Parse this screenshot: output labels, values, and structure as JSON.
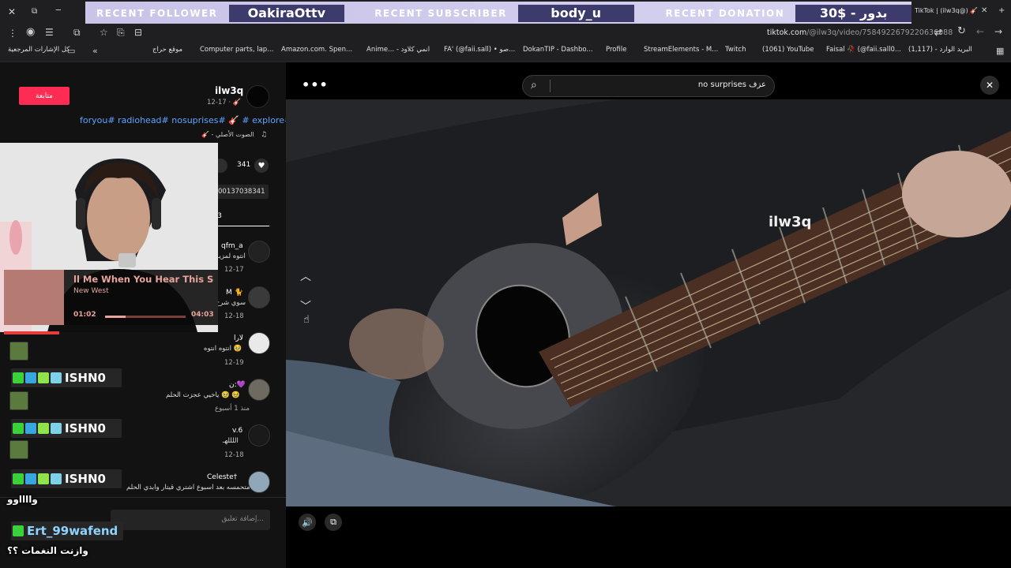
{
  "stream_overlay": {
    "recent_follower_label": "RECENT FOLLOWER",
    "recent_follower_value": "OakiraOttv",
    "recent_subscriber_label": "RECENT SUBSCRIBER",
    "recent_subscriber_value": "body_u",
    "recent_donation_label": "RECENT DONATION",
    "recent_donation_value": "30$ - بدور"
  },
  "browser": {
    "tab_title": "TikTok | (ilw3q@) 🎸",
    "url_host": "tiktok.com",
    "url_path": "/@ilw3q/video/7584922679220636088",
    "bookmarks_all_label": "كل الإشارات المرجعية",
    "bookmarks": [
      "موقع حراج",
      "Computer parts, lap...",
      "Amazon.com. Spen...",
      "Anime... - انمي كلاود",
      "FA' (@faii.sall) • صو...",
      "DokanTIP - Dashbo...",
      "Profile",
      "StreamElements - M...",
      "Twitch",
      "(1061) YouTube",
      "Faisal 🥀 (@faii.sall0...",
      "(1,117) - البريد الوارد"
    ]
  },
  "post": {
    "follow_label": "متابعة",
    "username": "ilw3q",
    "date": "12-17 · 🎸",
    "hashtags": "foryou# radiohead# nosuprises# 🎸 # explore#",
    "sound": "🎸 - الصوت الأصلي",
    "likes": "341",
    "link_fragment": "00137038341",
    "tab_count": "(3"
  },
  "comments": [
    {
      "name": "qfm_a",
      "text": "انتوه لمزيـ",
      "date": "12-17"
    },
    {
      "name": "M 🐈",
      "text": "سوي شرح لا هاتي",
      "date": "12-18"
    },
    {
      "name": "لارا",
      "text": "انتوه انتوه 🥹",
      "date": "12-19"
    },
    {
      "name": "ن:💜",
      "text": "ياخيي عجزت الحلم 🥹 🥹",
      "date": "منذ 1 أسبوع"
    },
    {
      "name": "v.6",
      "text": "اللللهـ",
      "date": "12-18"
    },
    {
      "name": "Celeste†",
      "text": "متحمسه بعد اسبوع اشتري قيتار وابدي الحلم",
      "date": ""
    }
  ],
  "comment_input_placeholder": "إضافة تعليق...",
  "search": {
    "value": "no surprises عزف"
  },
  "video": {
    "watermark": "ilw3q"
  },
  "now_playing": {
    "title": "ll Me When You Hear This So",
    "artist": "New West",
    "elapsed": "01:02",
    "duration": "04:03",
    "progress": 0.255
  },
  "chat": [
    {
      "name": "ISHN0",
      "message": ""
    },
    {
      "name": "ISHN0",
      "message": ""
    },
    {
      "name": "ISHN0",
      "message": "وااااوو"
    },
    {
      "name": "Ert_99wafend",
      "message": "وازنت النغمات ؟؟"
    }
  ],
  "icons": {
    "more": "ellipsis-icon",
    "close": "close-icon",
    "search": "search-icon",
    "up": "chevron-up-icon",
    "down": "chevron-down-icon",
    "volume": "volume-icon",
    "miniplayer": "miniplayer-icon"
  },
  "colors": {
    "follow_button": "#fe2c55",
    "hashtag": "#5fa4ff",
    "overlay_bar": "#c9c4e8",
    "overlay_value_bg": "#3c3b6b"
  }
}
